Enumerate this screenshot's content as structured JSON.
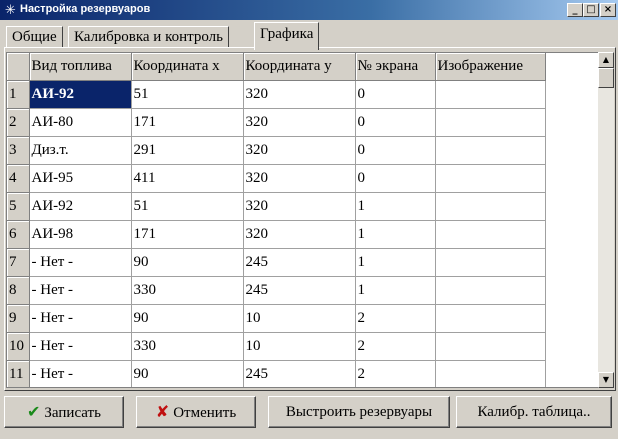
{
  "window": {
    "title": "Настройка резервуаров",
    "minimize": "_",
    "maximize": "□",
    "close": "×"
  },
  "tabs": [
    {
      "label": "Общие",
      "active": false
    },
    {
      "label": "Калибровка и контроль",
      "active": false
    },
    {
      "label": "Графика",
      "active": true
    }
  ],
  "grid": {
    "columns": [
      "",
      "Вид топлива",
      "Координата x",
      "Координата y",
      "№ экрана",
      "Изображение"
    ],
    "rows": [
      [
        "1",
        "АИ-92",
        "51",
        "320",
        "0",
        ""
      ],
      [
        "2",
        "АИ-80",
        "171",
        "320",
        "0",
        ""
      ],
      [
        "3",
        "Диз.т.",
        "291",
        "320",
        "0",
        ""
      ],
      [
        "4",
        "АИ-95",
        "411",
        "320",
        "0",
        ""
      ],
      [
        "5",
        "АИ-92",
        "51",
        "320",
        "1",
        ""
      ],
      [
        "6",
        "АИ-98",
        "171",
        "320",
        "1",
        ""
      ],
      [
        "7",
        " - Нет -",
        "90",
        "245",
        "1",
        ""
      ],
      [
        "8",
        " - Нет -",
        "330",
        "245",
        "1",
        ""
      ],
      [
        "9",
        " - Нет -",
        "90",
        "10",
        "2",
        ""
      ],
      [
        "10",
        " - Нет -",
        "330",
        "10",
        "2",
        ""
      ],
      [
        "11",
        " - Нет -",
        "90",
        "245",
        "2",
        ""
      ]
    ],
    "selected_row": 0,
    "selected_col": 1
  },
  "scrollbar": {
    "up": "▲",
    "down": "▼"
  },
  "buttons": {
    "save": {
      "label": "Записать",
      "icon": "✔",
      "icon_color": "#1a8a1a"
    },
    "cancel": {
      "label": "Отменить",
      "icon": "✘",
      "icon_color": "#c01010"
    },
    "arrange": {
      "label": "Выстроить резервуары"
    },
    "calib": {
      "label": "Калибр. таблица.."
    }
  },
  "colors": {
    "selection": "#0a246a",
    "face": "#d4d0c8"
  }
}
